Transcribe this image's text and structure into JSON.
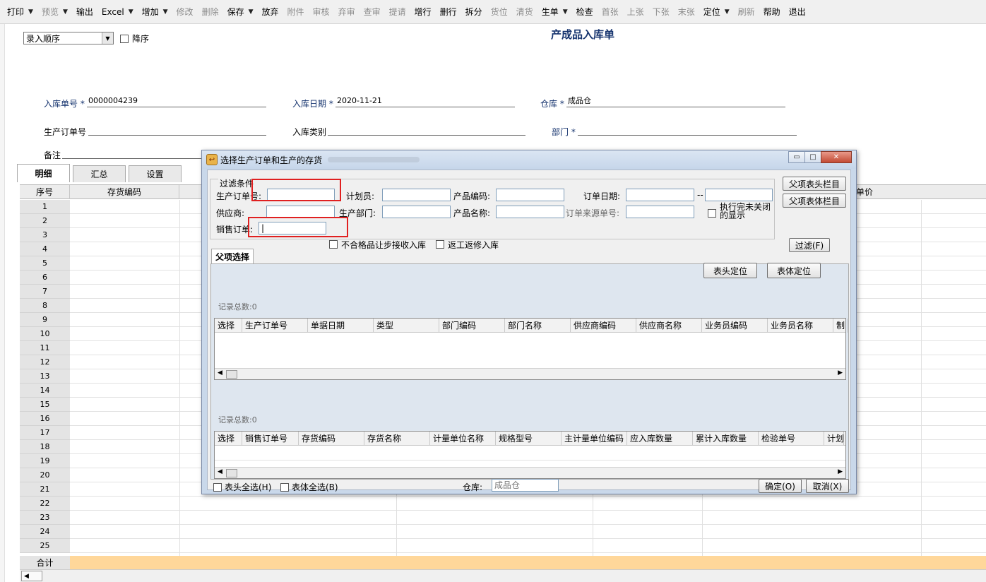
{
  "toolbar": {
    "print": "打印",
    "preview": "预览",
    "export": "输出",
    "excel": "Excel",
    "add": "增加",
    "modify": "修改",
    "delete": "删除",
    "save": "保存",
    "discard": "放弃",
    "attach": "附件",
    "review": "审核",
    "unreview": "弃审",
    "query_review": "查审",
    "submit": "提请",
    "add_row": "增行",
    "del_row": "删行",
    "split": "拆分",
    "location": "货位",
    "clear_location": "清货",
    "generate": "生单",
    "check": "检查",
    "first": "首张",
    "prev": "上张",
    "next": "下张",
    "last": "末张",
    "locate": "定位",
    "refresh": "刷新",
    "help": "帮助",
    "exit": "退出"
  },
  "header": {
    "sort_value": "录入顺序",
    "desc_label": "降序",
    "title": "产成品入库单"
  },
  "form": {
    "receipt_no_label": "入库单号",
    "receipt_no": "0000004239",
    "receipt_date_label": "入库日期",
    "receipt_date": "2020-11-21",
    "warehouse_label": "仓库",
    "warehouse": "成品仓",
    "prod_order_label": "生产订单号",
    "receipt_type_label": "入库类别",
    "dept_label": "部门",
    "remark_label": "备注",
    "required_mark": "*"
  },
  "tabs": [
    "明细",
    "汇总",
    "设置"
  ],
  "grid": {
    "columns": {
      "seq": "序号",
      "inv_code": "存货编码",
      "unit_price": "单价"
    },
    "rows": [
      "1",
      "2",
      "3",
      "4",
      "5",
      "6",
      "7",
      "8",
      "9",
      "10",
      "11",
      "12",
      "13",
      "14",
      "15",
      "16",
      "17",
      "18",
      "19",
      "20",
      "21",
      "22",
      "23",
      "24",
      "25"
    ],
    "total_label": "合计"
  },
  "dialog": {
    "title": "选择生产订单和生产的存货",
    "filter_legend": "过滤条件",
    "prod_order_label": "生产订单号:",
    "planner_label": "计划员:",
    "product_code_label": "产品编码:",
    "order_date_label": "订单日期:",
    "date_sep": "--",
    "supplier_label": "供应商:",
    "prod_dept_label": "生产部门:",
    "product_name_label": "产品名称:",
    "order_source_label": "订单来源单号:",
    "show_closed_label": "执行完未关闭的显示",
    "sales_order_label": "销售订单:",
    "sales_order_value": "|",
    "parent_header_cols_btn": "父项表头栏目",
    "parent_body_cols_btn": "父项表体栏目",
    "filter_btn": "过滤(F)",
    "parent_tab": "父项选择",
    "nonconforming_label": "不合格品让步接收入库",
    "rework_label": "返工返修入库",
    "header_locate_btn": "表头定位",
    "body_locate_btn": "表体定位",
    "record_count_1": "记录总数:0",
    "record_count_2": "记录总数:0",
    "grid1_cols": [
      "选择",
      "生产订单号",
      "单据日期",
      "类型",
      "部门编码",
      "部门名称",
      "供应商编码",
      "供应商名称",
      "业务员编码",
      "业务员名称",
      "制"
    ],
    "grid2_cols": [
      "选择",
      "销售订单号",
      "存货编码",
      "存货名称",
      "计量单位名称",
      "规格型号",
      "主计量单位编码",
      "应入库数量",
      "累计入库数量",
      "检验单号",
      "计划"
    ],
    "select_all_header": "表头全选(H)",
    "select_all_body": "表体全选(B)",
    "warehouse_label": "仓库:",
    "warehouse_value": "成品仓",
    "ok_btn": "确定(O)",
    "cancel_btn": "取消(X)"
  },
  "colors": {
    "title_blue": "#15336e",
    "highlight_red": "#e02020",
    "total_row": "#ffd79a"
  }
}
